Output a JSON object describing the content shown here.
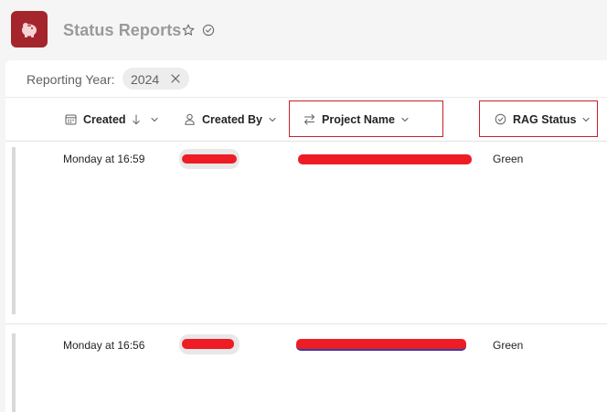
{
  "app": {
    "title": "Status Reports",
    "accent_color": "#a4262c",
    "icon": "piggy-bank-icon"
  },
  "filter": {
    "label": "Reporting Year:",
    "chip_value": "2024"
  },
  "columns": [
    {
      "label": "Created",
      "icon": "calendar-icon",
      "sort": "descending"
    },
    {
      "label": "Created By",
      "icon": "person-icon"
    },
    {
      "label": "Project Name",
      "icon": "swap-arrows-icon"
    },
    {
      "label": "RAG Status",
      "icon": "check-circle-icon"
    }
  ],
  "rows": [
    {
      "created": "Monday at 16:59",
      "created_by": "[redacted]",
      "project_name": "[redacted]",
      "rag_status": "Green"
    },
    {
      "created": "Monday at 16:56",
      "created_by": "[redacted]",
      "project_name": "[redacted]",
      "rag_status": "Green"
    }
  ]
}
